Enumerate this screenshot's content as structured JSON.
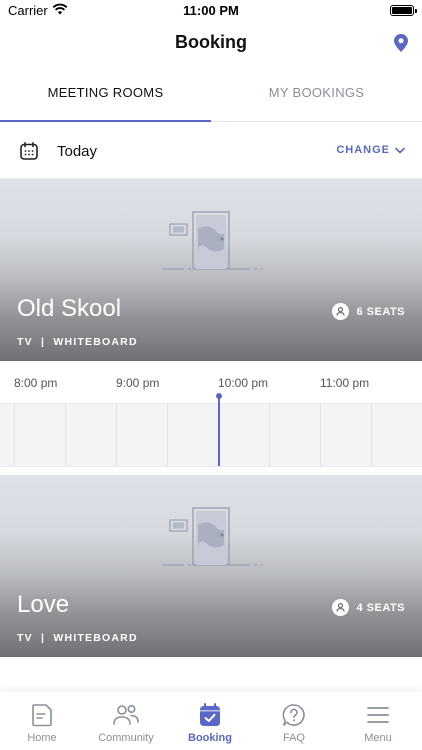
{
  "status_bar": {
    "carrier": "Carrier",
    "time": "11:00 PM"
  },
  "nav": {
    "title": "Booking",
    "location_icon": "location-pin-icon"
  },
  "tabs": [
    {
      "label": "MEETING ROOMS",
      "active": true
    },
    {
      "label": "MY BOOKINGS",
      "active": false
    }
  ],
  "date_row": {
    "label": "Today",
    "change_label": "CHANGE",
    "icon": "calendar-icon"
  },
  "timeline": {
    "times": [
      "8:00 pm",
      "9:00 pm",
      "10:00 pm",
      "11:00 pm"
    ]
  },
  "rooms": [
    {
      "name": "Old Skool",
      "tags": "TV  |  WHITEBOARD",
      "seats": "6 SEATS"
    },
    {
      "name": "Love",
      "tags": "TV  |  WHITEBOARD",
      "seats": "4 SEATS"
    }
  ],
  "tab_bar": {
    "items": [
      {
        "label": "Home",
        "icon": "home-icon",
        "active": false
      },
      {
        "label": "Community",
        "icon": "community-icon",
        "active": false
      },
      {
        "label": "Booking",
        "icon": "booking-icon",
        "active": true
      },
      {
        "label": "FAQ",
        "icon": "faq-icon",
        "active": false
      },
      {
        "label": "Menu",
        "icon": "menu-icon",
        "active": false
      }
    ]
  },
  "colors": {
    "accent": "#5b67c7",
    "muted": "#8a8f98"
  }
}
